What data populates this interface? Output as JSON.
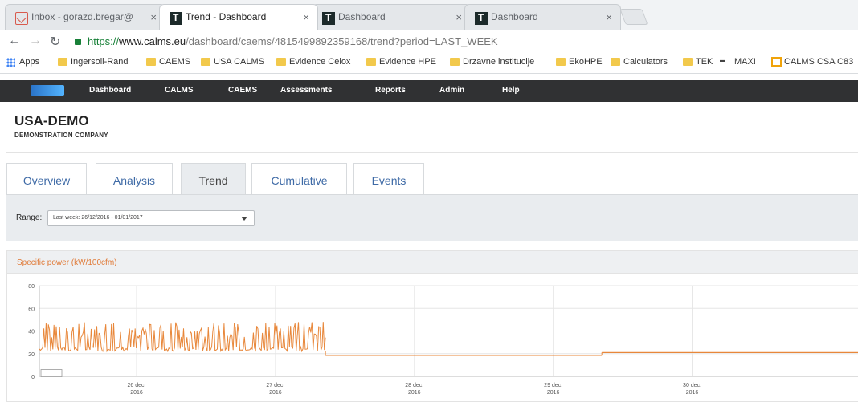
{
  "browser": {
    "tabs": [
      {
        "title": "Inbox - gorazd.bregar@",
        "icon": "gmail-icon"
      },
      {
        "title": "Trend - Dashboard",
        "icon": "calms-icon",
        "active": true
      },
      {
        "title": "Dashboard",
        "icon": "calms-icon"
      },
      {
        "title": "Dashboard",
        "icon": "calms-icon"
      }
    ],
    "close_glyph": "×",
    "address": {
      "scheme": "https://",
      "domain": "www.calms.eu",
      "path": "/dashboard/caems/4815499892359168/trend?period=LAST_WEEK"
    },
    "bookmarks": [
      {
        "label": "Apps",
        "icon": "apps-icon"
      },
      {
        "label": "Ingersoll-Rand",
        "icon": "folder-icon"
      },
      {
        "label": "CAEMS",
        "icon": "folder-icon"
      },
      {
        "label": "USA CALMS",
        "icon": "folder-icon"
      },
      {
        "label": "Evidence Celox",
        "icon": "folder-icon"
      },
      {
        "label": "Evidence HPE",
        "icon": "folder-icon"
      },
      {
        "label": "Drzavne institucije",
        "icon": "folder-icon"
      },
      {
        "label": "EkoHPE",
        "icon": "folder-icon"
      },
      {
        "label": "Calculators",
        "icon": "folder-icon"
      },
      {
        "label": "TEK",
        "icon": "folder-icon"
      },
      {
        "label": "MAX!",
        "icon": "max-icon"
      },
      {
        "label": "CALMS CSA C83",
        "icon": "calms-bookmark-icon"
      }
    ]
  },
  "app_nav": {
    "items": [
      "Dashboard",
      "CALMS",
      "CAEMS",
      "Assessments",
      "Reports",
      "Admin",
      "Help"
    ]
  },
  "company": {
    "name": "USA-DEMO",
    "subtitle": "DEMONSTRATION COMPANY"
  },
  "page_tabs": [
    {
      "label": "Overview"
    },
    {
      "label": "Analysis"
    },
    {
      "label": "Trend",
      "active": true
    },
    {
      "label": "Cumulative"
    },
    {
      "label": "Events"
    }
  ],
  "range": {
    "label": "Range:",
    "selected": "Last week: 26/12/2016 - 01/01/2017"
  },
  "colors": {
    "series": "#e8873a",
    "nav_bg": "#303133",
    "link": "#3e6aa6"
  },
  "chart_data": {
    "type": "line",
    "title": "Specific power (kW/100cfm)",
    "ylim": [
      0,
      80
    ],
    "yticks": [
      0,
      20,
      40,
      60,
      80
    ],
    "xlim": [
      0,
      5.9
    ],
    "x_ticks": [
      {
        "x": 0.7,
        "label": [
          "26 dec.",
          "2016"
        ]
      },
      {
        "x": 1.7,
        "label": [
          "27 dec.",
          "2016"
        ]
      },
      {
        "x": 2.7,
        "label": [
          "28 dec.",
          "2016"
        ]
      },
      {
        "x": 3.7,
        "label": [
          "29 dec.",
          "2016"
        ]
      },
      {
        "x": 4.7,
        "label": [
          "30 dec.",
          "2016"
        ]
      }
    ],
    "grid": true,
    "series": [
      {
        "segments": [
          {
            "x0": 0.0,
            "x1": 2.06,
            "low": 22,
            "high": 48,
            "noisy": true
          },
          {
            "x0": 2.06,
            "x1": 4.05,
            "value": 18.5
          },
          {
            "x0": 4.05,
            "x1": 5.9,
            "value": 21
          }
        ]
      }
    ]
  }
}
